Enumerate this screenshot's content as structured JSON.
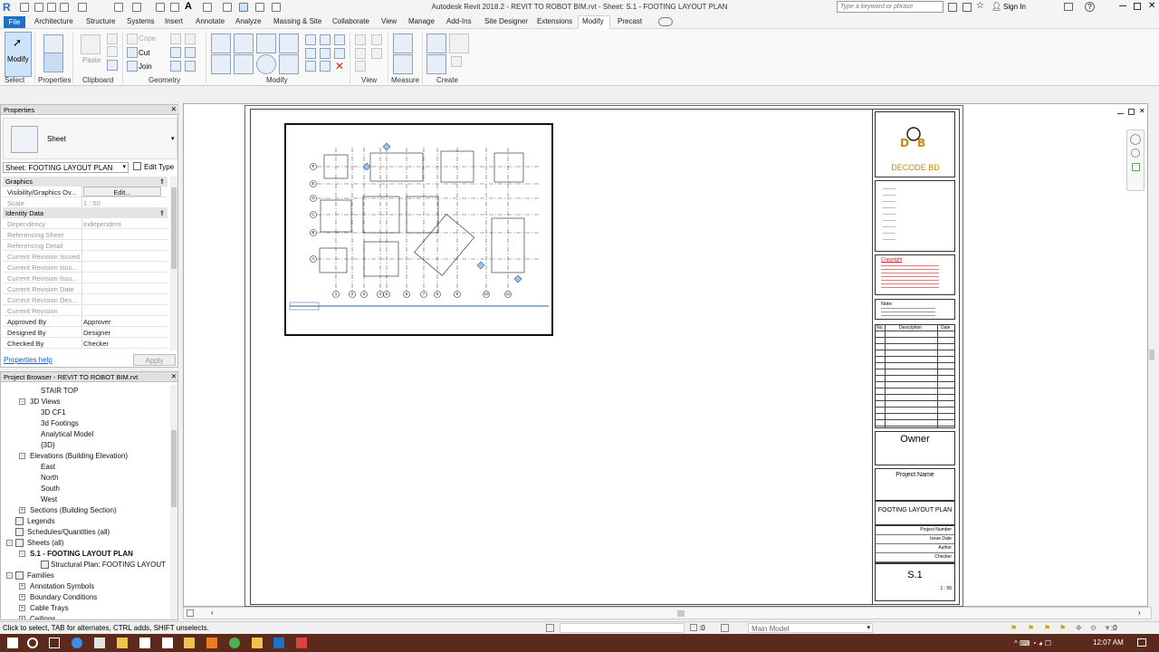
{
  "title_bar": {
    "app_title": "Autodesk Revit 2018.2 -    REVIT TO ROBOT BIM.rvt - Sheet: S.1 - FOOTING LAYOUT PLAN",
    "search_placeholder": "Type a keyword or phrase",
    "sign_in": "Sign In"
  },
  "ribbon_tabs": [
    "File",
    "Architecture",
    "Structure",
    "Systems",
    "Insert",
    "Annotate",
    "Analyze",
    "Massing & Site",
    "Collaborate",
    "View",
    "Manage",
    "Add-Ins",
    "Site Designer",
    "Extensions",
    "Modify",
    "Precast"
  ],
  "ribbon": {
    "modify_label": "Modify",
    "paste_label": "Paste",
    "cope_label": "Cope",
    "cut_label": "Cut",
    "join_label": "Join",
    "panels": [
      "Select",
      "Properties",
      "Clipboard",
      "Geometry",
      "Modify",
      "View",
      "Measure",
      "Create"
    ]
  },
  "properties": {
    "header": "Properties",
    "type_name": "Sheet",
    "instance_selector": "Sheet: FOOTING LAYOUT PLAN",
    "edit_type": "Edit Type",
    "sections": {
      "graphics": "Graphics",
      "identity": "Identity Data"
    },
    "rows_graphics": [
      {
        "k": "Visibility/Graphics Ov...",
        "v": "Edit..."
      },
      {
        "k": "Scale",
        "v": "1 : 50"
      }
    ],
    "rows_identity": [
      {
        "k": "Dependency",
        "v": "Independent"
      },
      {
        "k": "Referencing Sheet",
        "v": ""
      },
      {
        "k": "Referencing Detail",
        "v": ""
      },
      {
        "k": "Current Revision Issued",
        "v": ""
      },
      {
        "k": "Current Revision Issu...",
        "v": ""
      },
      {
        "k": "Current Revision Issu...",
        "v": ""
      },
      {
        "k": "Current Revision Date",
        "v": ""
      },
      {
        "k": "Current Revision Des...",
        "v": ""
      },
      {
        "k": "Current Revision",
        "v": ""
      },
      {
        "k": "Approved By",
        "v": "Approver"
      },
      {
        "k": "Designed By",
        "v": "Designer"
      },
      {
        "k": "Checked By",
        "v": "Checker"
      }
    ],
    "help_link": "Properties help",
    "apply": "Apply"
  },
  "browser": {
    "header": "Project Browser - REVIT TO ROBOT BIM.rvt",
    "items": [
      {
        "label": "STAIR TOP",
        "indent": 3
      },
      {
        "label": "3D Views",
        "indent": 2,
        "exp": "-"
      },
      {
        "label": "3D CF1",
        "indent": 3
      },
      {
        "label": "3d Footings",
        "indent": 3
      },
      {
        "label": "Analytical Model",
        "indent": 3
      },
      {
        "label": "{3D}",
        "indent": 3
      },
      {
        "label": "Elevations (Building Elevation)",
        "indent": 2,
        "exp": "-"
      },
      {
        "label": "East",
        "indent": 3
      },
      {
        "label": "North",
        "indent": 3
      },
      {
        "label": "South",
        "indent": 3
      },
      {
        "label": "West",
        "indent": 3
      },
      {
        "label": "Sections (Building Section)",
        "indent": 2,
        "exp": "+"
      },
      {
        "label": "Legends",
        "indent": 1,
        "icon": true
      },
      {
        "label": "Schedules/Quantities (all)",
        "indent": 1,
        "icon": true
      },
      {
        "label": "Sheets (all)",
        "indent": 1,
        "exp": "-",
        "icon": true
      },
      {
        "label": "S.1 - FOOTING LAYOUT PLAN",
        "indent": 2,
        "exp": "-",
        "bold": true
      },
      {
        "label": "Structural Plan: FOOTING LAYOUT",
        "indent": 3,
        "icon": true
      },
      {
        "label": "Families",
        "indent": 1,
        "exp": "-",
        "icon": true
      },
      {
        "label": "Annotation Symbols",
        "indent": 2,
        "exp": "+"
      },
      {
        "label": "Boundary Conditions",
        "indent": 2,
        "exp": "+"
      },
      {
        "label": "Cable Trays",
        "indent": 2,
        "exp": "+"
      },
      {
        "label": "Ceilings",
        "indent": 2,
        "exp": "+"
      }
    ]
  },
  "titleblock": {
    "logo_text": "DECODE BD",
    "copyright_title": "Copyright",
    "note_title": "Note:",
    "rev_headers": [
      "No.",
      "Description",
      "Date"
    ],
    "owner": "Owner",
    "project_name": "Project Name",
    "sheet_title": "FOOTING LAYOUT PLAN",
    "project_number": "Project Number",
    "issue_date": "Issue Date",
    "author": "Author",
    "checker": "Checker",
    "sheet_number": "S.1",
    "scale": "1 : 50"
  },
  "plan": {
    "grid_rows": [
      "F",
      "E",
      "D",
      "C",
      "B",
      "A"
    ],
    "grid_cols": [
      "1",
      "2",
      "3",
      "4",
      "5",
      "6",
      "7",
      "8",
      "9",
      "10",
      "11"
    ]
  },
  "status": {
    "message": "Click to select, TAB for alternates, CTRL adds, SHIFT unselects.",
    "zero": ":0",
    "model": "Main Model",
    "filter_count": ":0"
  },
  "taskbar": {
    "time": "12:07 AM"
  }
}
